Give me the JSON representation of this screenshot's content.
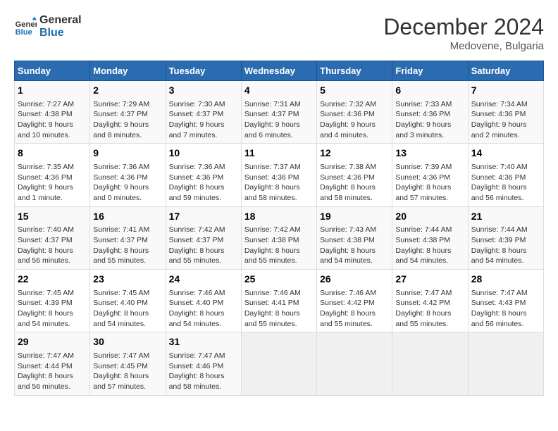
{
  "header": {
    "logo_line1": "General",
    "logo_line2": "Blue",
    "month_year": "December 2024",
    "location": "Medovene, Bulgaria"
  },
  "weekdays": [
    "Sunday",
    "Monday",
    "Tuesday",
    "Wednesday",
    "Thursday",
    "Friday",
    "Saturday"
  ],
  "weeks": [
    [
      {
        "day": "1",
        "sunrise": "7:27 AM",
        "sunset": "4:38 PM",
        "daylight": "9 hours and 10 minutes."
      },
      {
        "day": "2",
        "sunrise": "7:29 AM",
        "sunset": "4:37 PM",
        "daylight": "9 hours and 8 minutes."
      },
      {
        "day": "3",
        "sunrise": "7:30 AM",
        "sunset": "4:37 PM",
        "daylight": "9 hours and 7 minutes."
      },
      {
        "day": "4",
        "sunrise": "7:31 AM",
        "sunset": "4:37 PM",
        "daylight": "9 hours and 6 minutes."
      },
      {
        "day": "5",
        "sunrise": "7:32 AM",
        "sunset": "4:36 PM",
        "daylight": "9 hours and 4 minutes."
      },
      {
        "day": "6",
        "sunrise": "7:33 AM",
        "sunset": "4:36 PM",
        "daylight": "9 hours and 3 minutes."
      },
      {
        "day": "7",
        "sunrise": "7:34 AM",
        "sunset": "4:36 PM",
        "daylight": "9 hours and 2 minutes."
      }
    ],
    [
      {
        "day": "8",
        "sunrise": "7:35 AM",
        "sunset": "4:36 PM",
        "daylight": "9 hours and 1 minute."
      },
      {
        "day": "9",
        "sunrise": "7:36 AM",
        "sunset": "4:36 PM",
        "daylight": "9 hours and 0 minutes."
      },
      {
        "day": "10",
        "sunrise": "7:36 AM",
        "sunset": "4:36 PM",
        "daylight": "8 hours and 59 minutes."
      },
      {
        "day": "11",
        "sunrise": "7:37 AM",
        "sunset": "4:36 PM",
        "daylight": "8 hours and 58 minutes."
      },
      {
        "day": "12",
        "sunrise": "7:38 AM",
        "sunset": "4:36 PM",
        "daylight": "8 hours and 58 minutes."
      },
      {
        "day": "13",
        "sunrise": "7:39 AM",
        "sunset": "4:36 PM",
        "daylight": "8 hours and 57 minutes."
      },
      {
        "day": "14",
        "sunrise": "7:40 AM",
        "sunset": "4:36 PM",
        "daylight": "8 hours and 56 minutes."
      }
    ],
    [
      {
        "day": "15",
        "sunrise": "7:40 AM",
        "sunset": "4:37 PM",
        "daylight": "8 hours and 56 minutes."
      },
      {
        "day": "16",
        "sunrise": "7:41 AM",
        "sunset": "4:37 PM",
        "daylight": "8 hours and 55 minutes."
      },
      {
        "day": "17",
        "sunrise": "7:42 AM",
        "sunset": "4:37 PM",
        "daylight": "8 hours and 55 minutes."
      },
      {
        "day": "18",
        "sunrise": "7:42 AM",
        "sunset": "4:38 PM",
        "daylight": "8 hours and 55 minutes."
      },
      {
        "day": "19",
        "sunrise": "7:43 AM",
        "sunset": "4:38 PM",
        "daylight": "8 hours and 54 minutes."
      },
      {
        "day": "20",
        "sunrise": "7:44 AM",
        "sunset": "4:38 PM",
        "daylight": "8 hours and 54 minutes."
      },
      {
        "day": "21",
        "sunrise": "7:44 AM",
        "sunset": "4:39 PM",
        "daylight": "8 hours and 54 minutes."
      }
    ],
    [
      {
        "day": "22",
        "sunrise": "7:45 AM",
        "sunset": "4:39 PM",
        "daylight": "8 hours and 54 minutes."
      },
      {
        "day": "23",
        "sunrise": "7:45 AM",
        "sunset": "4:40 PM",
        "daylight": "8 hours and 54 minutes."
      },
      {
        "day": "24",
        "sunrise": "7:46 AM",
        "sunset": "4:40 PM",
        "daylight": "8 hours and 54 minutes."
      },
      {
        "day": "25",
        "sunrise": "7:46 AM",
        "sunset": "4:41 PM",
        "daylight": "8 hours and 55 minutes."
      },
      {
        "day": "26",
        "sunrise": "7:46 AM",
        "sunset": "4:42 PM",
        "daylight": "8 hours and 55 minutes."
      },
      {
        "day": "27",
        "sunrise": "7:47 AM",
        "sunset": "4:42 PM",
        "daylight": "8 hours and 55 minutes."
      },
      {
        "day": "28",
        "sunrise": "7:47 AM",
        "sunset": "4:43 PM",
        "daylight": "8 hours and 56 minutes."
      }
    ],
    [
      {
        "day": "29",
        "sunrise": "7:47 AM",
        "sunset": "4:44 PM",
        "daylight": "8 hours and 56 minutes."
      },
      {
        "day": "30",
        "sunrise": "7:47 AM",
        "sunset": "4:45 PM",
        "daylight": "8 hours and 57 minutes."
      },
      {
        "day": "31",
        "sunrise": "7:47 AM",
        "sunset": "4:46 PM",
        "daylight": "8 hours and 58 minutes."
      },
      null,
      null,
      null,
      null
    ]
  ],
  "labels": {
    "sunrise": "Sunrise:",
    "sunset": "Sunset:",
    "daylight": "Daylight:"
  }
}
